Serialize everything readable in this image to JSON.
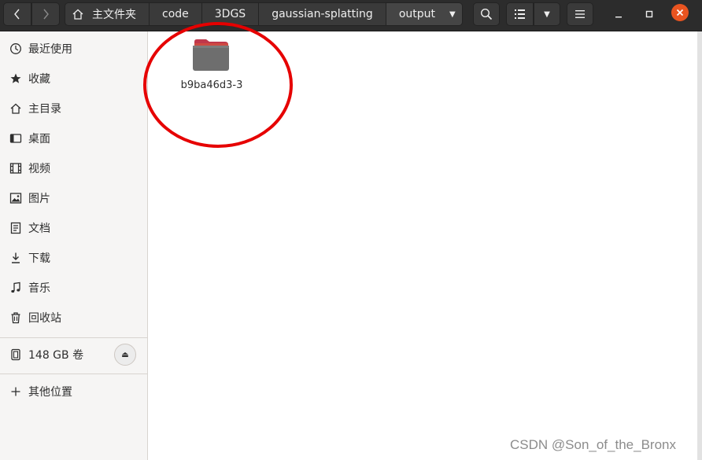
{
  "header": {
    "breadcrumbs": [
      {
        "label": "主文件夹"
      },
      {
        "label": "code"
      },
      {
        "label": "3DGS"
      },
      {
        "label": "gaussian-splatting"
      },
      {
        "label": "output"
      }
    ]
  },
  "sidebar": {
    "items": [
      {
        "label": "最近使用",
        "icon": "clock-icon"
      },
      {
        "label": "收藏",
        "icon": "star-icon"
      },
      {
        "label": "主目录",
        "icon": "home-icon"
      },
      {
        "label": "桌面",
        "icon": "desktop-icon"
      },
      {
        "label": "视频",
        "icon": "film-icon"
      },
      {
        "label": "图片",
        "icon": "image-icon"
      },
      {
        "label": "文档",
        "icon": "document-icon"
      },
      {
        "label": "下载",
        "icon": "download-icon"
      },
      {
        "label": "音乐",
        "icon": "music-icon"
      },
      {
        "label": "回收站",
        "icon": "trash-icon"
      }
    ],
    "volume": {
      "label": "148 GB 卷",
      "icon": "drive-icon"
    },
    "other_locations": {
      "label": "其他位置",
      "icon": "plus-icon"
    }
  },
  "main": {
    "items": [
      {
        "name": "b9ba46d3-3",
        "type": "folder"
      }
    ]
  },
  "annotation": {
    "shape": "circle",
    "color": "#e60000"
  },
  "watermark": "CSDN @Son_of_the_Bronx",
  "colors": {
    "headerbar": "#2c2c2c",
    "close_button": "#e95420",
    "folder_body": "#6e6e6e",
    "folder_tab": "#c0384b"
  }
}
